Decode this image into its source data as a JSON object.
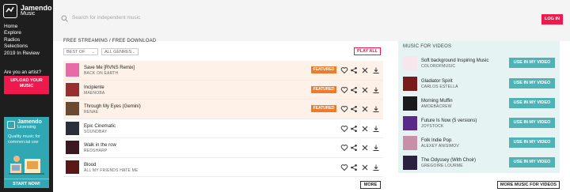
{
  "app": {
    "logo_line1": "Jamendo",
    "logo_line2": "Music",
    "brand_color": "#f0194d"
  },
  "sidebar": {
    "nav": [
      "Home",
      "Explore",
      "Radios",
      "Selections",
      "2019 In Review"
    ],
    "artist_question": "Are you an artist?",
    "upload_button": "UPLOAD YOUR MUSIC",
    "promo": {
      "brand1": "Jamendo",
      "brand2": "Licensing",
      "tagline": "Quality music for commercial use",
      "start": "START NOW!"
    }
  },
  "topbar": {
    "search_placeholder": "Search for independent music",
    "login": "LOG IN"
  },
  "main": {
    "section_title": "FREE STREAMING / FREE DOWNLOAD",
    "filters": [
      "BEST OF",
      "ALL GENRES"
    ],
    "play_all": "PLAY ALL",
    "more": "MORE",
    "tracks": [
      {
        "title": "Save Me [RVNS Remix]",
        "artist": "BACK ON EARTH",
        "featured": "FEATURED",
        "thumb": "#e86aa6"
      },
      {
        "title": "Incipiente",
        "artist": "MAENOBA",
        "featured": "FEATURED",
        "thumb": "#9a2d2d"
      },
      {
        "title": "Through My Eyes (Gemini)",
        "artist": "RENAE",
        "featured": "FEATURED",
        "thumb": "#6b4a2f"
      },
      {
        "title": "Epic Cinematic",
        "artist": "SOUNDBAY",
        "featured": "",
        "thumb": "#2a2f3a"
      },
      {
        "title": "Walk in the row",
        "artist": "REDSHARP",
        "featured": "",
        "thumb": "#3a1a22"
      },
      {
        "title": "Blood",
        "artist": "ALL MY FRIENDS HATE ME",
        "featured": "",
        "thumb": "#5a1818"
      }
    ]
  },
  "videos": {
    "title": "MUSIC FOR VIDEOS",
    "use_button": "USE IN MY VIDEO",
    "more": "MORE MUSIC FOR VIDEOS",
    "items": [
      {
        "title": "Soft background Inspiring Music",
        "artist": "COLOROFMUSIC",
        "thumb": "#f7e6ee"
      },
      {
        "title": "Gladiator Spirit",
        "artist": "CARLOS ESTELLA",
        "thumb": "#7a1a1a"
      },
      {
        "title": "Morning Muffin",
        "artist": "AMOEBACREW",
        "thumb": "#1a1a1a"
      },
      {
        "title": "Future Is Now (5 versions)",
        "artist": "JOYSTOCK",
        "thumb": "#5a2a8a"
      },
      {
        "title": "Folk Indie Pop",
        "artist": "ALEXEY ANISIMOV",
        "thumb": "#c98fa8"
      },
      {
        "title": "The Odyssey (With Choir)",
        "artist": "GREGOIRE LOURME",
        "thumb": "#2a2040"
      }
    ]
  }
}
